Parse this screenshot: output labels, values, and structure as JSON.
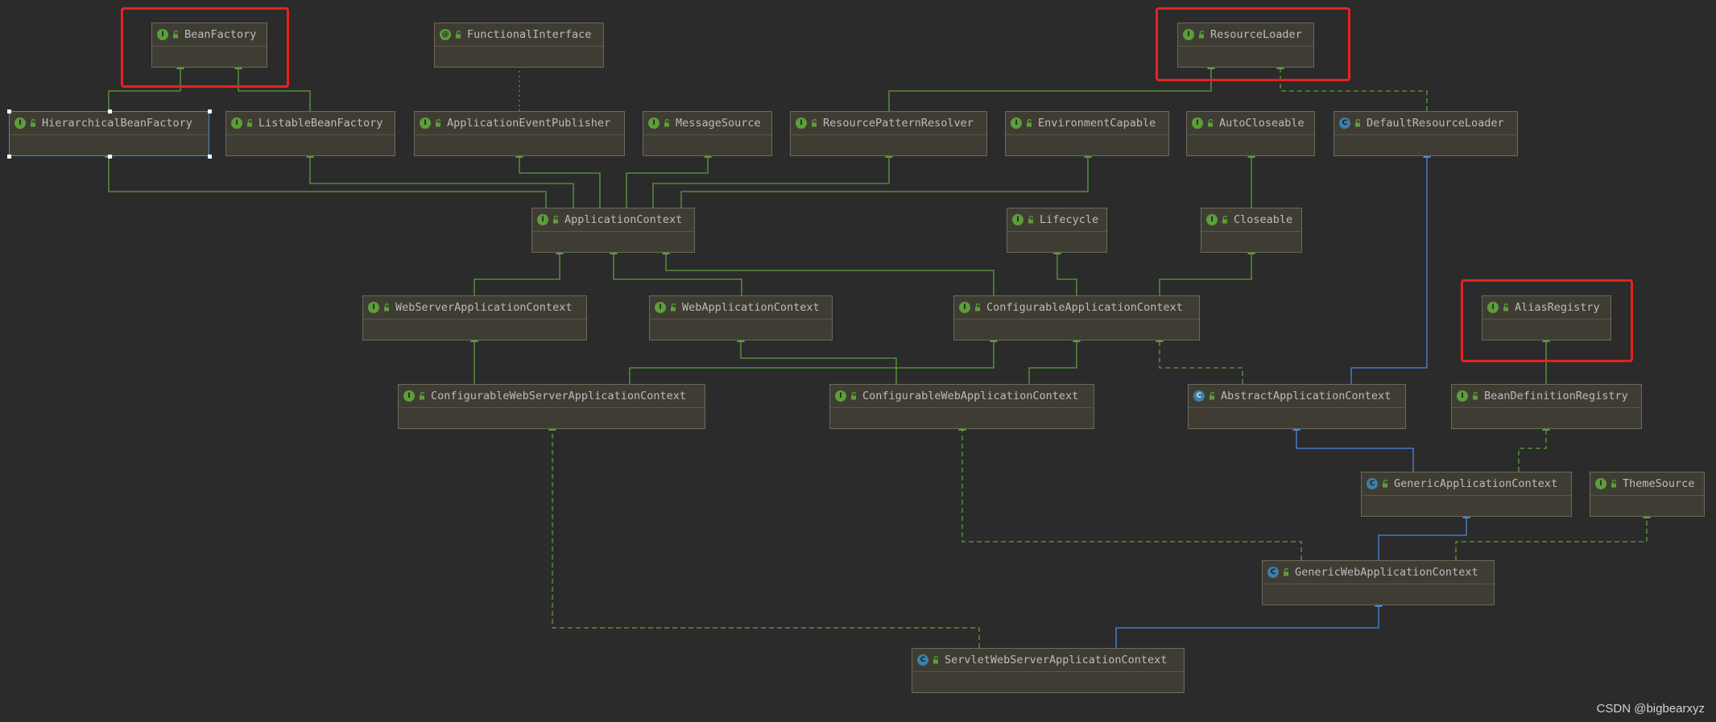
{
  "diagram": {
    "colors": {
      "background": "#2b2b2b",
      "node_fill": "#3f3d33",
      "extends_edge": "#5c9e3a",
      "implements_edge": "#5c9e3a",
      "class_extends_edge": "#4a88e0",
      "highlight": "#e8221f",
      "selection": "#4a88c7"
    },
    "nodes": [
      {
        "id": "BeanFactory",
        "label": "BeanFactory",
        "kind": "interface",
        "kind_icon": "interface-icon",
        "highlighted": true
      },
      {
        "id": "FunctionalInterface",
        "label": "FunctionalInterface",
        "kind": "annotation",
        "kind_icon": "annotation-icon"
      },
      {
        "id": "ResourceLoader",
        "label": "ResourceLoader",
        "kind": "interface",
        "kind_icon": "interface-icon",
        "highlighted": true
      },
      {
        "id": "HierarchicalBeanFactory",
        "label": "HierarchicalBeanFactory",
        "kind": "interface",
        "kind_icon": "interface-icon",
        "selected": true
      },
      {
        "id": "ListableBeanFactory",
        "label": "ListableBeanFactory",
        "kind": "interface",
        "kind_icon": "interface-icon"
      },
      {
        "id": "ApplicationEventPublisher",
        "label": "ApplicationEventPublisher",
        "kind": "interface",
        "kind_icon": "interface-icon"
      },
      {
        "id": "MessageSource",
        "label": "MessageSource",
        "kind": "interface",
        "kind_icon": "interface-icon"
      },
      {
        "id": "ResourcePatternResolver",
        "label": "ResourcePatternResolver",
        "kind": "interface",
        "kind_icon": "interface-icon"
      },
      {
        "id": "EnvironmentCapable",
        "label": "EnvironmentCapable",
        "kind": "interface",
        "kind_icon": "interface-icon"
      },
      {
        "id": "AutoCloseable",
        "label": "AutoCloseable",
        "kind": "interface",
        "kind_icon": "interface-icon"
      },
      {
        "id": "DefaultResourceLoader",
        "label": "DefaultResourceLoader",
        "kind": "class",
        "kind_icon": "class-icon"
      },
      {
        "id": "ApplicationContext",
        "label": "ApplicationContext",
        "kind": "interface",
        "kind_icon": "interface-icon"
      },
      {
        "id": "Lifecycle",
        "label": "Lifecycle",
        "kind": "interface",
        "kind_icon": "interface-icon"
      },
      {
        "id": "Closeable",
        "label": "Closeable",
        "kind": "interface",
        "kind_icon": "interface-icon"
      },
      {
        "id": "WebServerApplicationContext",
        "label": "WebServerApplicationContext",
        "kind": "interface",
        "kind_icon": "interface-icon"
      },
      {
        "id": "WebApplicationContext",
        "label": "WebApplicationContext",
        "kind": "interface",
        "kind_icon": "interface-icon"
      },
      {
        "id": "ConfigurableApplicationContext",
        "label": "ConfigurableApplicationContext",
        "kind": "interface",
        "kind_icon": "interface-icon"
      },
      {
        "id": "AliasRegistry",
        "label": "AliasRegistry",
        "kind": "interface",
        "kind_icon": "interface-icon",
        "highlighted": true
      },
      {
        "id": "ConfigurableWebServerApplicationContext",
        "label": "ConfigurableWebServerApplicationContext",
        "kind": "interface",
        "kind_icon": "interface-icon"
      },
      {
        "id": "ConfigurableWebApplicationContext",
        "label": "ConfigurableWebApplicationContext",
        "kind": "interface",
        "kind_icon": "interface-icon"
      },
      {
        "id": "AbstractApplicationContext",
        "label": "AbstractApplicationContext",
        "kind": "abstract",
        "kind_icon": "abstract-class-icon"
      },
      {
        "id": "BeanDefinitionRegistry",
        "label": "BeanDefinitionRegistry",
        "kind": "interface",
        "kind_icon": "interface-icon"
      },
      {
        "id": "GenericApplicationContext",
        "label": "GenericApplicationContext",
        "kind": "class",
        "kind_icon": "class-icon"
      },
      {
        "id": "ThemeSource",
        "label": "ThemeSource",
        "kind": "interface",
        "kind_icon": "interface-icon"
      },
      {
        "id": "GenericWebApplicationContext",
        "label": "GenericWebApplicationContext",
        "kind": "class",
        "kind_icon": "class-icon"
      },
      {
        "id": "ServletWebServerApplicationContext",
        "label": "ServletWebServerApplicationContext",
        "kind": "class",
        "kind_icon": "class-icon"
      }
    ],
    "edges": [
      {
        "from": "HierarchicalBeanFactory",
        "to": "BeanFactory",
        "type": "extends"
      },
      {
        "from": "ListableBeanFactory",
        "to": "BeanFactory",
        "type": "extends"
      },
      {
        "from": "ApplicationEventPublisher",
        "to": "FunctionalInterface",
        "type": "annotated"
      },
      {
        "from": "ResourcePatternResolver",
        "to": "ResourceLoader",
        "type": "extends"
      },
      {
        "from": "DefaultResourceLoader",
        "to": "ResourceLoader",
        "type": "implements"
      },
      {
        "from": "ApplicationContext",
        "to": "HierarchicalBeanFactory",
        "type": "extends"
      },
      {
        "from": "ApplicationContext",
        "to": "ListableBeanFactory",
        "type": "extends"
      },
      {
        "from": "ApplicationContext",
        "to": "ApplicationEventPublisher",
        "type": "extends"
      },
      {
        "from": "ApplicationContext",
        "to": "MessageSource",
        "type": "extends"
      },
      {
        "from": "ApplicationContext",
        "to": "ResourcePatternResolver",
        "type": "extends"
      },
      {
        "from": "ApplicationContext",
        "to": "EnvironmentCapable",
        "type": "extends"
      },
      {
        "from": "Closeable",
        "to": "AutoCloseable",
        "type": "extends"
      },
      {
        "from": "WebServerApplicationContext",
        "to": "ApplicationContext",
        "type": "extends"
      },
      {
        "from": "WebApplicationContext",
        "to": "ApplicationContext",
        "type": "extends"
      },
      {
        "from": "ConfigurableApplicationContext",
        "to": "ApplicationContext",
        "type": "extends"
      },
      {
        "from": "ConfigurableApplicationContext",
        "to": "Lifecycle",
        "type": "extends"
      },
      {
        "from": "ConfigurableApplicationContext",
        "to": "Closeable",
        "type": "extends"
      },
      {
        "from": "ConfigurableWebServerApplicationContext",
        "to": "WebServerApplicationContext",
        "type": "extends"
      },
      {
        "from": "ConfigurableWebServerApplicationContext",
        "to": "ConfigurableApplicationContext",
        "type": "extends"
      },
      {
        "from": "ConfigurableWebApplicationContext",
        "to": "WebApplicationContext",
        "type": "extends"
      },
      {
        "from": "ConfigurableWebApplicationContext",
        "to": "ConfigurableApplicationContext",
        "type": "extends"
      },
      {
        "from": "AbstractApplicationContext",
        "to": "ConfigurableApplicationContext",
        "type": "implements"
      },
      {
        "from": "AbstractApplicationContext",
        "to": "DefaultResourceLoader",
        "type": "class-extends"
      },
      {
        "from": "BeanDefinitionRegistry",
        "to": "AliasRegistry",
        "type": "extends"
      },
      {
        "from": "GenericApplicationContext",
        "to": "AbstractApplicationContext",
        "type": "class-extends"
      },
      {
        "from": "GenericApplicationContext",
        "to": "BeanDefinitionRegistry",
        "type": "implements"
      },
      {
        "from": "GenericWebApplicationContext",
        "to": "GenericApplicationContext",
        "type": "class-extends"
      },
      {
        "from": "GenericWebApplicationContext",
        "to": "ConfigurableWebApplicationContext",
        "type": "implements"
      },
      {
        "from": "GenericWebApplicationContext",
        "to": "ThemeSource",
        "type": "implements"
      },
      {
        "from": "ServletWebServerApplicationContext",
        "to": "GenericWebApplicationContext",
        "type": "class-extends"
      },
      {
        "from": "ServletWebServerApplicationContext",
        "to": "ConfigurableWebServerApplicationContext",
        "type": "implements"
      }
    ]
  },
  "watermark": "CSDN @bigbearxyz"
}
